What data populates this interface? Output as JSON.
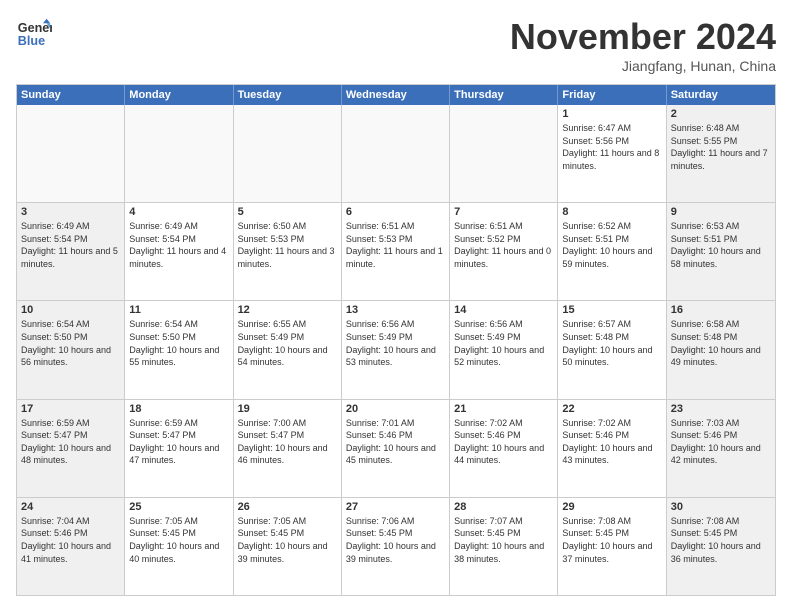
{
  "logo": {
    "text1": "General",
    "text2": "Blue"
  },
  "header": {
    "month": "November 2024",
    "location": "Jiangfang, Hunan, China"
  },
  "weekdays": [
    "Sunday",
    "Monday",
    "Tuesday",
    "Wednesday",
    "Thursday",
    "Friday",
    "Saturday"
  ],
  "rows": [
    [
      {
        "day": "",
        "empty": true
      },
      {
        "day": "",
        "empty": true
      },
      {
        "day": "",
        "empty": true
      },
      {
        "day": "",
        "empty": true
      },
      {
        "day": "",
        "empty": true
      },
      {
        "day": "1",
        "sunrise": "Sunrise: 6:47 AM",
        "sunset": "Sunset: 5:56 PM",
        "daylight": "Daylight: 11 hours and 8 minutes."
      },
      {
        "day": "2",
        "sunrise": "Sunrise: 6:48 AM",
        "sunset": "Sunset: 5:55 PM",
        "daylight": "Daylight: 11 hours and 7 minutes."
      }
    ],
    [
      {
        "day": "3",
        "sunrise": "Sunrise: 6:49 AM",
        "sunset": "Sunset: 5:54 PM",
        "daylight": "Daylight: 11 hours and 5 minutes."
      },
      {
        "day": "4",
        "sunrise": "Sunrise: 6:49 AM",
        "sunset": "Sunset: 5:54 PM",
        "daylight": "Daylight: 11 hours and 4 minutes."
      },
      {
        "day": "5",
        "sunrise": "Sunrise: 6:50 AM",
        "sunset": "Sunset: 5:53 PM",
        "daylight": "Daylight: 11 hours and 3 minutes."
      },
      {
        "day": "6",
        "sunrise": "Sunrise: 6:51 AM",
        "sunset": "Sunset: 5:53 PM",
        "daylight": "Daylight: 11 hours and 1 minute."
      },
      {
        "day": "7",
        "sunrise": "Sunrise: 6:51 AM",
        "sunset": "Sunset: 5:52 PM",
        "daylight": "Daylight: 11 hours and 0 minutes."
      },
      {
        "day": "8",
        "sunrise": "Sunrise: 6:52 AM",
        "sunset": "Sunset: 5:51 PM",
        "daylight": "Daylight: 10 hours and 59 minutes."
      },
      {
        "day": "9",
        "sunrise": "Sunrise: 6:53 AM",
        "sunset": "Sunset: 5:51 PM",
        "daylight": "Daylight: 10 hours and 58 minutes."
      }
    ],
    [
      {
        "day": "10",
        "sunrise": "Sunrise: 6:54 AM",
        "sunset": "Sunset: 5:50 PM",
        "daylight": "Daylight: 10 hours and 56 minutes."
      },
      {
        "day": "11",
        "sunrise": "Sunrise: 6:54 AM",
        "sunset": "Sunset: 5:50 PM",
        "daylight": "Daylight: 10 hours and 55 minutes."
      },
      {
        "day": "12",
        "sunrise": "Sunrise: 6:55 AM",
        "sunset": "Sunset: 5:49 PM",
        "daylight": "Daylight: 10 hours and 54 minutes."
      },
      {
        "day": "13",
        "sunrise": "Sunrise: 6:56 AM",
        "sunset": "Sunset: 5:49 PM",
        "daylight": "Daylight: 10 hours and 53 minutes."
      },
      {
        "day": "14",
        "sunrise": "Sunrise: 6:56 AM",
        "sunset": "Sunset: 5:49 PM",
        "daylight": "Daylight: 10 hours and 52 minutes."
      },
      {
        "day": "15",
        "sunrise": "Sunrise: 6:57 AM",
        "sunset": "Sunset: 5:48 PM",
        "daylight": "Daylight: 10 hours and 50 minutes."
      },
      {
        "day": "16",
        "sunrise": "Sunrise: 6:58 AM",
        "sunset": "Sunset: 5:48 PM",
        "daylight": "Daylight: 10 hours and 49 minutes."
      }
    ],
    [
      {
        "day": "17",
        "sunrise": "Sunrise: 6:59 AM",
        "sunset": "Sunset: 5:47 PM",
        "daylight": "Daylight: 10 hours and 48 minutes."
      },
      {
        "day": "18",
        "sunrise": "Sunrise: 6:59 AM",
        "sunset": "Sunset: 5:47 PM",
        "daylight": "Daylight: 10 hours and 47 minutes."
      },
      {
        "day": "19",
        "sunrise": "Sunrise: 7:00 AM",
        "sunset": "Sunset: 5:47 PM",
        "daylight": "Daylight: 10 hours and 46 minutes."
      },
      {
        "day": "20",
        "sunrise": "Sunrise: 7:01 AM",
        "sunset": "Sunset: 5:46 PM",
        "daylight": "Daylight: 10 hours and 45 minutes."
      },
      {
        "day": "21",
        "sunrise": "Sunrise: 7:02 AM",
        "sunset": "Sunset: 5:46 PM",
        "daylight": "Daylight: 10 hours and 44 minutes."
      },
      {
        "day": "22",
        "sunrise": "Sunrise: 7:02 AM",
        "sunset": "Sunset: 5:46 PM",
        "daylight": "Daylight: 10 hours and 43 minutes."
      },
      {
        "day": "23",
        "sunrise": "Sunrise: 7:03 AM",
        "sunset": "Sunset: 5:46 PM",
        "daylight": "Daylight: 10 hours and 42 minutes."
      }
    ],
    [
      {
        "day": "24",
        "sunrise": "Sunrise: 7:04 AM",
        "sunset": "Sunset: 5:46 PM",
        "daylight": "Daylight: 10 hours and 41 minutes."
      },
      {
        "day": "25",
        "sunrise": "Sunrise: 7:05 AM",
        "sunset": "Sunset: 5:45 PM",
        "daylight": "Daylight: 10 hours and 40 minutes."
      },
      {
        "day": "26",
        "sunrise": "Sunrise: 7:05 AM",
        "sunset": "Sunset: 5:45 PM",
        "daylight": "Daylight: 10 hours and 39 minutes."
      },
      {
        "day": "27",
        "sunrise": "Sunrise: 7:06 AM",
        "sunset": "Sunset: 5:45 PM",
        "daylight": "Daylight: 10 hours and 39 minutes."
      },
      {
        "day": "28",
        "sunrise": "Sunrise: 7:07 AM",
        "sunset": "Sunset: 5:45 PM",
        "daylight": "Daylight: 10 hours and 38 minutes."
      },
      {
        "day": "29",
        "sunrise": "Sunrise: 7:08 AM",
        "sunset": "Sunset: 5:45 PM",
        "daylight": "Daylight: 10 hours and 37 minutes."
      },
      {
        "day": "30",
        "sunrise": "Sunrise: 7:08 AM",
        "sunset": "Sunset: 5:45 PM",
        "daylight": "Daylight: 10 hours and 36 minutes."
      }
    ]
  ]
}
